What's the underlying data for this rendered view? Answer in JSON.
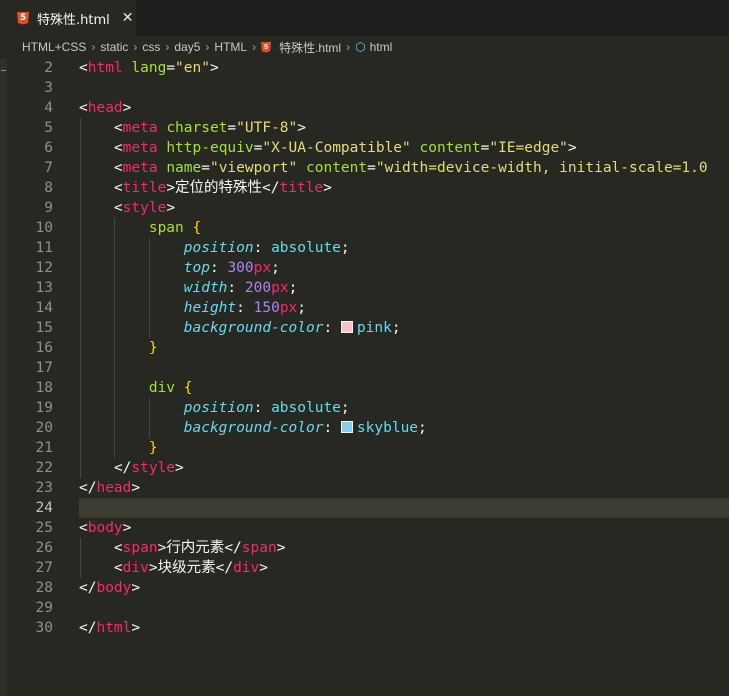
{
  "tab": {
    "title": "特殊性.html",
    "icon": "html5-icon",
    "close": "✕"
  },
  "breadcrumb": {
    "items": [
      "HTML+CSS",
      "static",
      "css",
      "day5",
      "HTML",
      "特殊性.html",
      "html"
    ],
    "separator": "›"
  },
  "editor": {
    "current_line": 24,
    "colors": {
      "pink": "#ffc0cb",
      "skyblue": "#87ceeb"
    },
    "lines": [
      {
        "n": "2",
        "tokens": [
          [
            "pu",
            "<"
          ],
          [
            "tg",
            "html"
          ],
          [
            "pu",
            " "
          ],
          [
            "at",
            "lang"
          ],
          [
            "pu",
            "="
          ],
          [
            "st",
            "\"en\""
          ],
          [
            "pu",
            ">"
          ]
        ]
      },
      {
        "n": "3",
        "tokens": []
      },
      {
        "n": "4",
        "tokens": [
          [
            "pu",
            "<"
          ],
          [
            "tg",
            "head"
          ],
          [
            "pu",
            ">"
          ]
        ]
      },
      {
        "n": "5",
        "tokens": [
          [
            "pu",
            "    <"
          ],
          [
            "tg",
            "meta"
          ],
          [
            "pu",
            " "
          ],
          [
            "at",
            "charset"
          ],
          [
            "pu",
            "="
          ],
          [
            "st",
            "\"UTF-8\""
          ],
          [
            "pu",
            ">"
          ]
        ]
      },
      {
        "n": "6",
        "tokens": [
          [
            "pu",
            "    <"
          ],
          [
            "tg",
            "meta"
          ],
          [
            "pu",
            " "
          ],
          [
            "at",
            "http-equiv"
          ],
          [
            "pu",
            "="
          ],
          [
            "st",
            "\"X-UA-Compatible\""
          ],
          [
            "pu",
            " "
          ],
          [
            "at",
            "content"
          ],
          [
            "pu",
            "="
          ],
          [
            "st",
            "\"IE=edge\""
          ],
          [
            "pu",
            ">"
          ]
        ]
      },
      {
        "n": "7",
        "tokens": [
          [
            "pu",
            "    <"
          ],
          [
            "tg",
            "meta"
          ],
          [
            "pu",
            " "
          ],
          [
            "at",
            "name"
          ],
          [
            "pu",
            "="
          ],
          [
            "st",
            "\"viewport\""
          ],
          [
            "pu",
            " "
          ],
          [
            "at",
            "content"
          ],
          [
            "pu",
            "="
          ],
          [
            "st",
            "\"width=device-width, initial-scale=1.0"
          ]
        ]
      },
      {
        "n": "8",
        "tokens": [
          [
            "pu",
            "    <"
          ],
          [
            "tg",
            "title"
          ],
          [
            "pu",
            ">"
          ],
          [
            "txt",
            "定位的特殊性"
          ],
          [
            "pu",
            "</"
          ],
          [
            "tg",
            "title"
          ],
          [
            "pu",
            ">"
          ]
        ]
      },
      {
        "n": "9",
        "tokens": [
          [
            "pu",
            "    <"
          ],
          [
            "tg",
            "style"
          ],
          [
            "pu",
            ">"
          ]
        ]
      },
      {
        "n": "10",
        "tokens": [
          [
            "pu",
            "        "
          ],
          [
            "sel",
            "span"
          ],
          [
            "pu",
            " "
          ],
          [
            "br",
            "{"
          ]
        ]
      },
      {
        "n": "11",
        "tokens": [
          [
            "pu",
            "            "
          ],
          [
            "pr",
            "position"
          ],
          [
            "pu",
            ": "
          ],
          [
            "vl",
            "absolute"
          ],
          [
            "pu",
            ";"
          ]
        ]
      },
      {
        "n": "12",
        "tokens": [
          [
            "pu",
            "            "
          ],
          [
            "pr",
            "top"
          ],
          [
            "pu",
            ": "
          ],
          [
            "nm",
            "300"
          ],
          [
            "un",
            "px"
          ],
          [
            "pu",
            ";"
          ]
        ]
      },
      {
        "n": "13",
        "tokens": [
          [
            "pu",
            "            "
          ],
          [
            "pr",
            "width"
          ],
          [
            "pu",
            ": "
          ],
          [
            "nm",
            "200"
          ],
          [
            "un",
            "px"
          ],
          [
            "pu",
            ";"
          ]
        ]
      },
      {
        "n": "14",
        "tokens": [
          [
            "pu",
            "            "
          ],
          [
            "pr",
            "height"
          ],
          [
            "pu",
            ": "
          ],
          [
            "nm",
            "150"
          ],
          [
            "un",
            "px"
          ],
          [
            "pu",
            ";"
          ]
        ]
      },
      {
        "n": "15",
        "tokens": [
          [
            "pu",
            "            "
          ],
          [
            "pr",
            "background-color"
          ],
          [
            "pu",
            ": "
          ],
          [
            "sw",
            "pink"
          ],
          [
            "vl",
            "pink"
          ],
          [
            "pu",
            ";"
          ]
        ]
      },
      {
        "n": "16",
        "tokens": [
          [
            "pu",
            "        "
          ],
          [
            "br",
            "}"
          ]
        ]
      },
      {
        "n": "17",
        "tokens": []
      },
      {
        "n": "18",
        "tokens": [
          [
            "pu",
            "        "
          ],
          [
            "sel",
            "div"
          ],
          [
            "pu",
            " "
          ],
          [
            "br",
            "{"
          ]
        ]
      },
      {
        "n": "19",
        "tokens": [
          [
            "pu",
            "            "
          ],
          [
            "pr",
            "position"
          ],
          [
            "pu",
            ": "
          ],
          [
            "vl",
            "absolute"
          ],
          [
            "pu",
            ";"
          ]
        ]
      },
      {
        "n": "20",
        "tokens": [
          [
            "pu",
            "            "
          ],
          [
            "pr",
            "background-color"
          ],
          [
            "pu",
            ": "
          ],
          [
            "sw",
            "skyblue"
          ],
          [
            "vl",
            "skyblue"
          ],
          [
            "pu",
            ";"
          ]
        ]
      },
      {
        "n": "21",
        "tokens": [
          [
            "pu",
            "        "
          ],
          [
            "br",
            "}"
          ]
        ]
      },
      {
        "n": "22",
        "tokens": [
          [
            "pu",
            "    </"
          ],
          [
            "tg",
            "style"
          ],
          [
            "pu",
            ">"
          ]
        ]
      },
      {
        "n": "23",
        "tokens": [
          [
            "pu",
            "</"
          ],
          [
            "tg",
            "head"
          ],
          [
            "pu",
            ">"
          ]
        ]
      },
      {
        "n": "24",
        "tokens": []
      },
      {
        "n": "25",
        "tokens": [
          [
            "pu",
            "<"
          ],
          [
            "tg",
            "body"
          ],
          [
            "pu",
            ">"
          ]
        ]
      },
      {
        "n": "26",
        "tokens": [
          [
            "pu",
            "    <"
          ],
          [
            "tg",
            "span"
          ],
          [
            "pu",
            ">"
          ],
          [
            "txt",
            "行内元素"
          ],
          [
            "pu",
            "</"
          ],
          [
            "tg",
            "span"
          ],
          [
            "pu",
            ">"
          ]
        ]
      },
      {
        "n": "27",
        "tokens": [
          [
            "pu",
            "    <"
          ],
          [
            "tg",
            "div"
          ],
          [
            "pu",
            ">"
          ],
          [
            "txt",
            "块级元素"
          ],
          [
            "pu",
            "</"
          ],
          [
            "tg",
            "div"
          ],
          [
            "pu",
            ">"
          ]
        ]
      },
      {
        "n": "28",
        "tokens": [
          [
            "pu",
            "</"
          ],
          [
            "tg",
            "body"
          ],
          [
            "pu",
            ">"
          ]
        ]
      },
      {
        "n": "29",
        "tokens": []
      },
      {
        "n": "30",
        "tokens": [
          [
            "pu",
            "</"
          ],
          [
            "tg",
            "html"
          ],
          [
            "pu",
            ">"
          ]
        ]
      }
    ]
  }
}
